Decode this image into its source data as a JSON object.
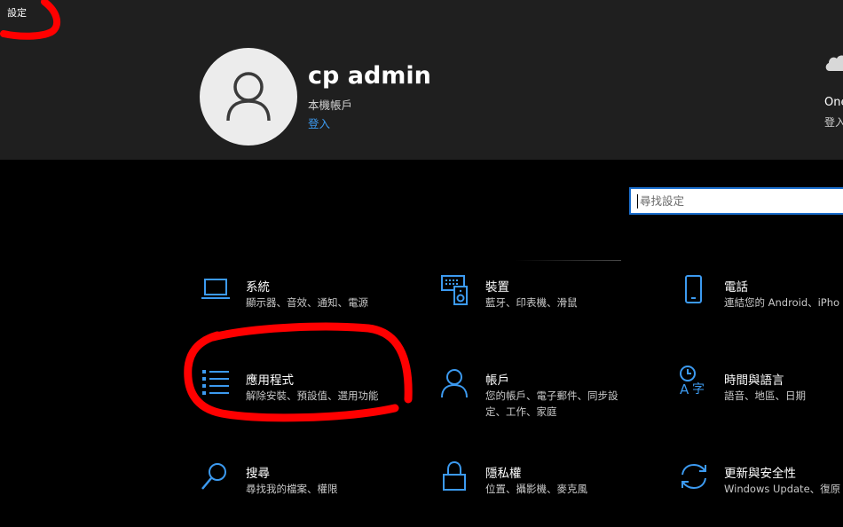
{
  "window": {
    "title": "設定"
  },
  "account": {
    "name": "cp admin",
    "type": "本機帳戶",
    "signin_link": "登入"
  },
  "onedrive": {
    "title": "One",
    "subtitle": "登入"
  },
  "search": {
    "placeholder": "尋找設定"
  },
  "tiles": [
    {
      "title": "系統",
      "desc": "顯示器、音效、通知、電源",
      "icon": "laptop-icon"
    },
    {
      "title": "裝置",
      "desc": "藍牙、印表機、滑鼠",
      "icon": "keyboard-speaker-icon"
    },
    {
      "title": "電話",
      "desc": "連結您的 Android、iPho",
      "icon": "phone-icon"
    },
    {
      "title": "應用程式",
      "desc": "解除安裝、預設值、選用功能",
      "icon": "apps-list-icon"
    },
    {
      "title": "帳戶",
      "desc": "您的帳戶、電子郵件、同步設定、工作、家庭",
      "icon": "person-icon"
    },
    {
      "title": "時間與語言",
      "desc": "語音、地區、日期",
      "icon": "time-language-icon"
    },
    {
      "title": "搜尋",
      "desc": "尋找我的檔案、權限",
      "icon": "search-icon"
    },
    {
      "title": "隱私權",
      "desc": "位置、攝影機、麥克風",
      "icon": "lock-icon"
    },
    {
      "title": "更新與安全性",
      "desc": "Windows Update、復原",
      "icon": "sync-icon"
    }
  ],
  "colors": {
    "accent": "#3c9af0",
    "annotation": "#ff0000",
    "header_bg": "#1f1f1f"
  }
}
